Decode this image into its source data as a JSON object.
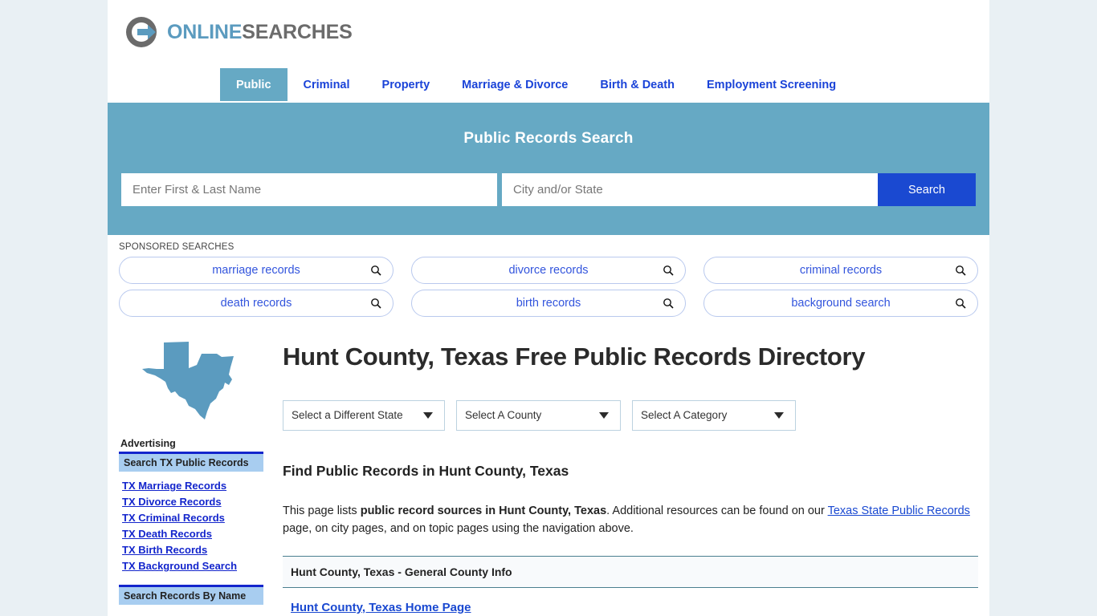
{
  "brand": {
    "name_part1": "ONLINE",
    "name_part2": "SEARCHES",
    "logo_icon": "circle-arrow-icon",
    "accent_blue": "#5b9bbf",
    "accent_gray": "#6b6b6b"
  },
  "nav": {
    "tabs": [
      {
        "label": "Public",
        "active": true
      },
      {
        "label": "Criminal",
        "active": false
      },
      {
        "label": "Property",
        "active": false
      },
      {
        "label": "Marriage & Divorce",
        "active": false
      },
      {
        "label": "Birth & Death",
        "active": false
      },
      {
        "label": "Employment Screening",
        "active": false
      }
    ]
  },
  "banner": {
    "title": "Public Records Search",
    "background": "#66a9c4",
    "name_placeholder": "Enter First & Last Name",
    "name_value": "",
    "city_placeholder": "City and/or State",
    "city_value": "",
    "search_label": "Search",
    "search_color": "#1a49d1"
  },
  "sponsored": {
    "label": "SPONSORED SEARCHES",
    "row1": [
      {
        "text": "marriage records",
        "icon": "search-icon"
      },
      {
        "text": "divorce records",
        "icon": "search-icon"
      },
      {
        "text": "criminal records",
        "icon": "search-icon"
      }
    ],
    "row2": [
      {
        "text": "death records",
        "icon": "search-icon"
      },
      {
        "text": "birth records",
        "icon": "search-icon"
      },
      {
        "text": "background search",
        "icon": "search-icon"
      }
    ]
  },
  "sidebar": {
    "state_map_icon": "texas-state-map-icon",
    "advertising_label": "Advertising",
    "box1_header": "Search TX Public Records",
    "links": [
      "TX Marriage Records",
      "TX Divorce Records",
      "TX Criminal Records",
      "TX Death Records",
      "TX Birth Records",
      "TX Background Search"
    ],
    "box2_header": "Search Records By Name"
  },
  "main": {
    "page_title": "Hunt County, Texas Free Public Records Directory",
    "selects": [
      {
        "label": "Select a Different State",
        "icon": "chevron-down-icon"
      },
      {
        "label": "Select A County",
        "icon": "chevron-down-icon"
      },
      {
        "label": "Select A Category",
        "icon": "chevron-down-icon"
      }
    ],
    "section_heading": "Find Public Records in Hunt County, Texas",
    "intro": {
      "part1": "This page lists ",
      "bold1": "public record sources in Hunt County, Texas",
      "part2": ". Additional resources can be found on our ",
      "link1": "Texas State Public Records",
      "part3": " page, on city pages, and on topic pages using the navigation above."
    },
    "table_header": "Hunt County, Texas - General County Info",
    "first_row_link": "Hunt County, Texas Home Page"
  }
}
